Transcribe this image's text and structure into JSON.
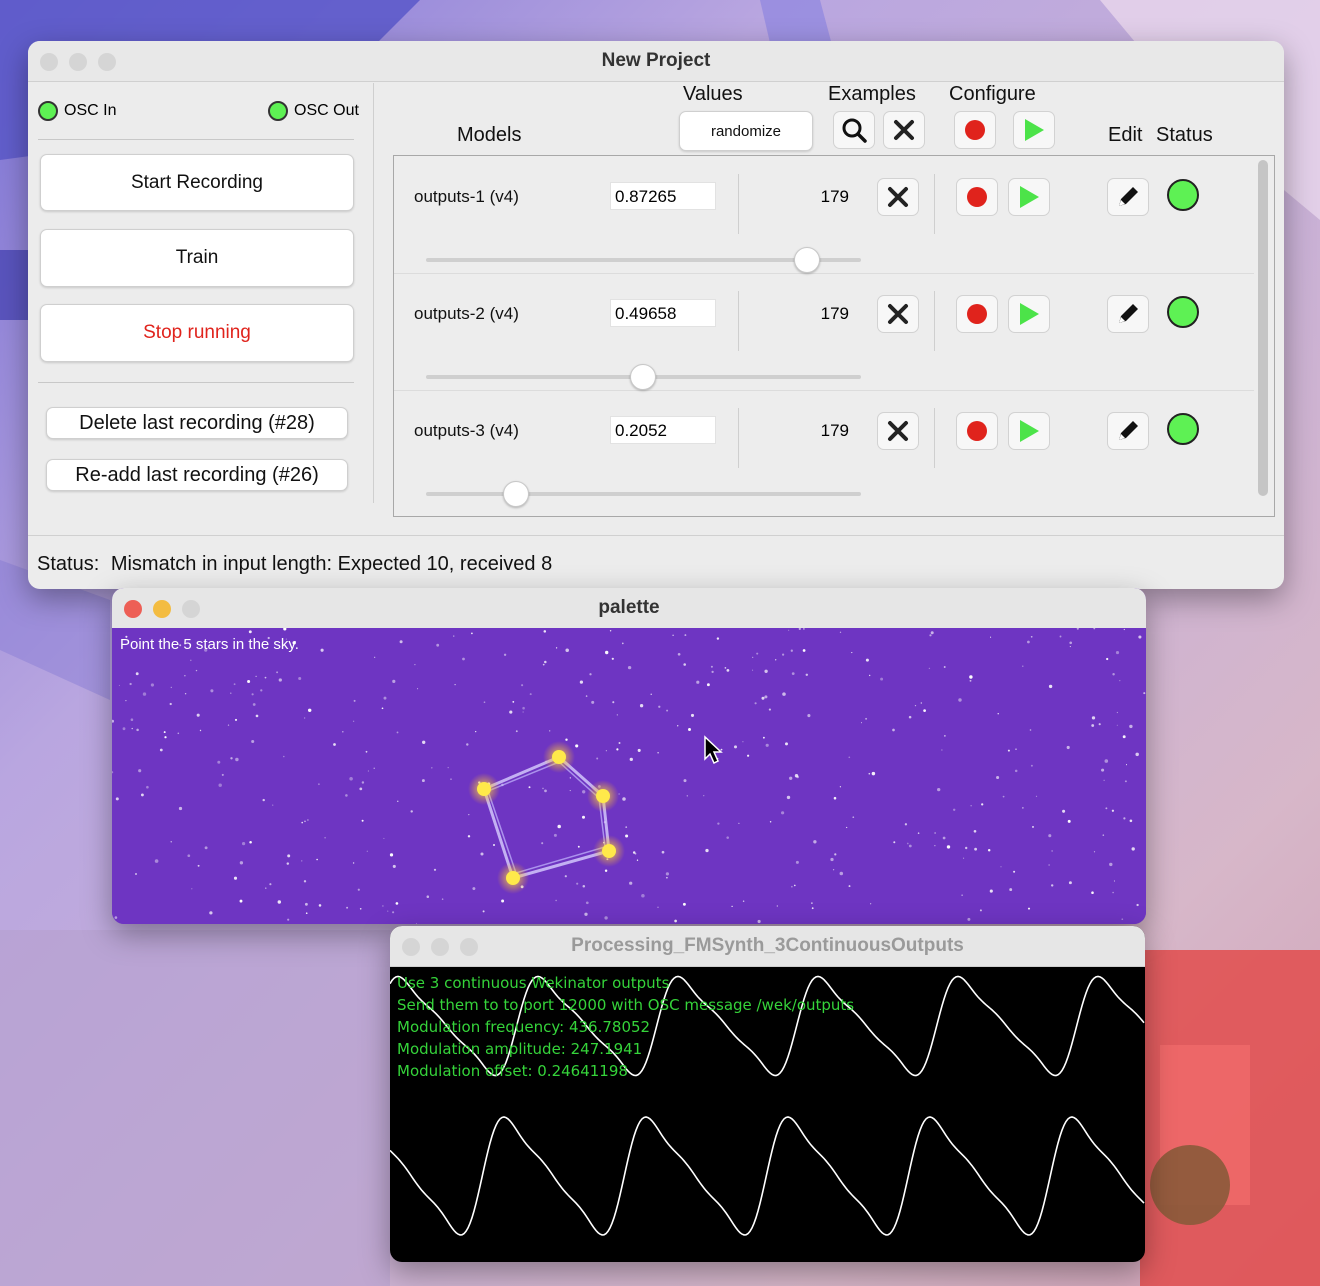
{
  "colors": {
    "accent_red": "#e0231c",
    "play_green": "#4ce349",
    "status_green": "#5ef154",
    "palette_bg": "#6e35c2",
    "star_yellow": "#ffe94a",
    "synth_text": "#35d33a"
  },
  "wekinator": {
    "title": "New Project",
    "osc_in_label": "OSC In",
    "osc_out_label": "OSC Out",
    "start_recording": "Start Recording",
    "train": "Train",
    "stop_running": "Stop running",
    "delete_last": "Delete last recording (#28)",
    "readd_last": "Re-add last recording (#26)",
    "headers": {
      "values": "Values",
      "examples": "Examples",
      "configure": "Configure",
      "models": "Models",
      "edit": "Edit",
      "status": "Status"
    },
    "randomize": "randomize",
    "icons": {
      "search": "search-icon",
      "delete": "close-icon",
      "record": "record-icon",
      "play": "play-icon",
      "edit": "pencil-icon"
    },
    "models": [
      {
        "name": "outputs-1 (v4)",
        "value": "0.87265",
        "examples": "179",
        "slider_fraction": 0.87265
      },
      {
        "name": "outputs-2 (v4)",
        "value": "0.49658",
        "examples": "179",
        "slider_fraction": 0.49658
      },
      {
        "name": "outputs-3 (v4)",
        "value": "0.2052",
        "examples": "179",
        "slider_fraction": 0.2052
      }
    ],
    "status_label": "Status:",
    "status_text": "Mismatch in input length: Expected 10, received 8"
  },
  "palette": {
    "title": "palette",
    "instruction": "Point the 5 stars in the sky."
  },
  "synth": {
    "title": "Processing_FMSynth_3ContinuousOutputs",
    "lines": [
      "Use 3 continuous Wekinator outputs",
      "Send them to to port 12000 with OSC message /wek/outputs",
      "Modulation frequency: 436.78052",
      "Modulation amplitude: 247.1941",
      "Modulation offset: 0.24641198"
    ]
  }
}
